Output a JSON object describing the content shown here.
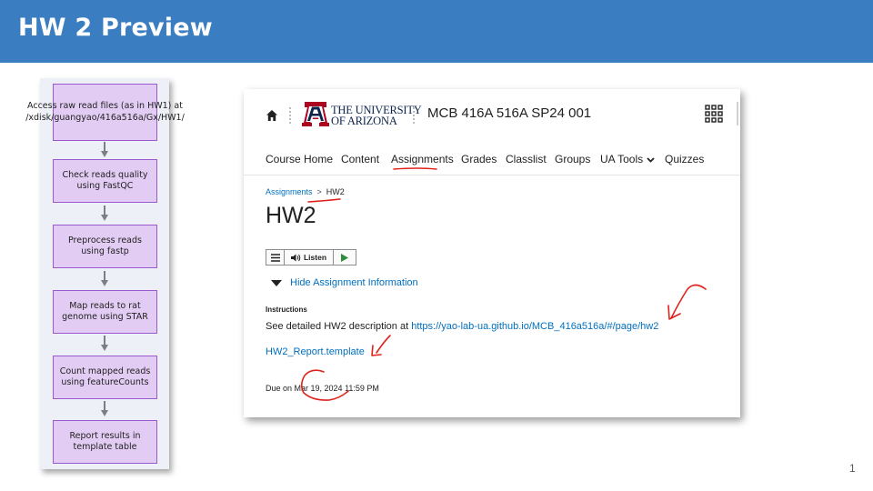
{
  "slide": {
    "title": "HW 2 Preview",
    "page_number": "1"
  },
  "flowchart": {
    "steps": [
      "Access raw read files (as in HW1) at /xdisk/guangyao/416a516a/Gx/HW1/",
      "Check reads quality using FastQC",
      "Preprocess reads using fastp",
      "Map reads to rat genome using STAR",
      "Count mapped reads using featureCounts",
      "Report results in template table"
    ]
  },
  "browser": {
    "header": {
      "logo_line1": "THE UNIVERSITY",
      "logo_line2": "OF ARIZONA",
      "course_name": "MCB 416A 516A SP24 001"
    },
    "nav": {
      "items": [
        "Course Home",
        "Content",
        "Assignments",
        "Grades",
        "Classlist",
        "Groups",
        "UA Tools",
        "Quizzes"
      ],
      "active": "Assignments"
    },
    "breadcrumb": {
      "parent": "Assignments",
      "separator": ">",
      "current": "HW2"
    },
    "page_title": "HW2",
    "listen_bar": {
      "label": "Listen"
    },
    "assignment": {
      "toggle_label": "Hide Assignment Information",
      "instructions_label": "Instructions",
      "description_prefix": "See detailed HW2 description at ",
      "description_link": "https://yao-lab-ua.github.io/MCB_416a516a/#/page/hw2",
      "template_link": "HW2_Report.template",
      "due_prefix": "Due on ",
      "due_date": "Mar 19, 2024 11:59 PM"
    }
  },
  "colors": {
    "title_bar": "#3a7dc1",
    "flow_box_fill": "#e2ccf3",
    "flow_box_border": "#9b59d0",
    "link": "#006fbf",
    "annotation": "#e0221c",
    "ua_navy": "#0c234b",
    "ua_red": "#ab0520"
  }
}
